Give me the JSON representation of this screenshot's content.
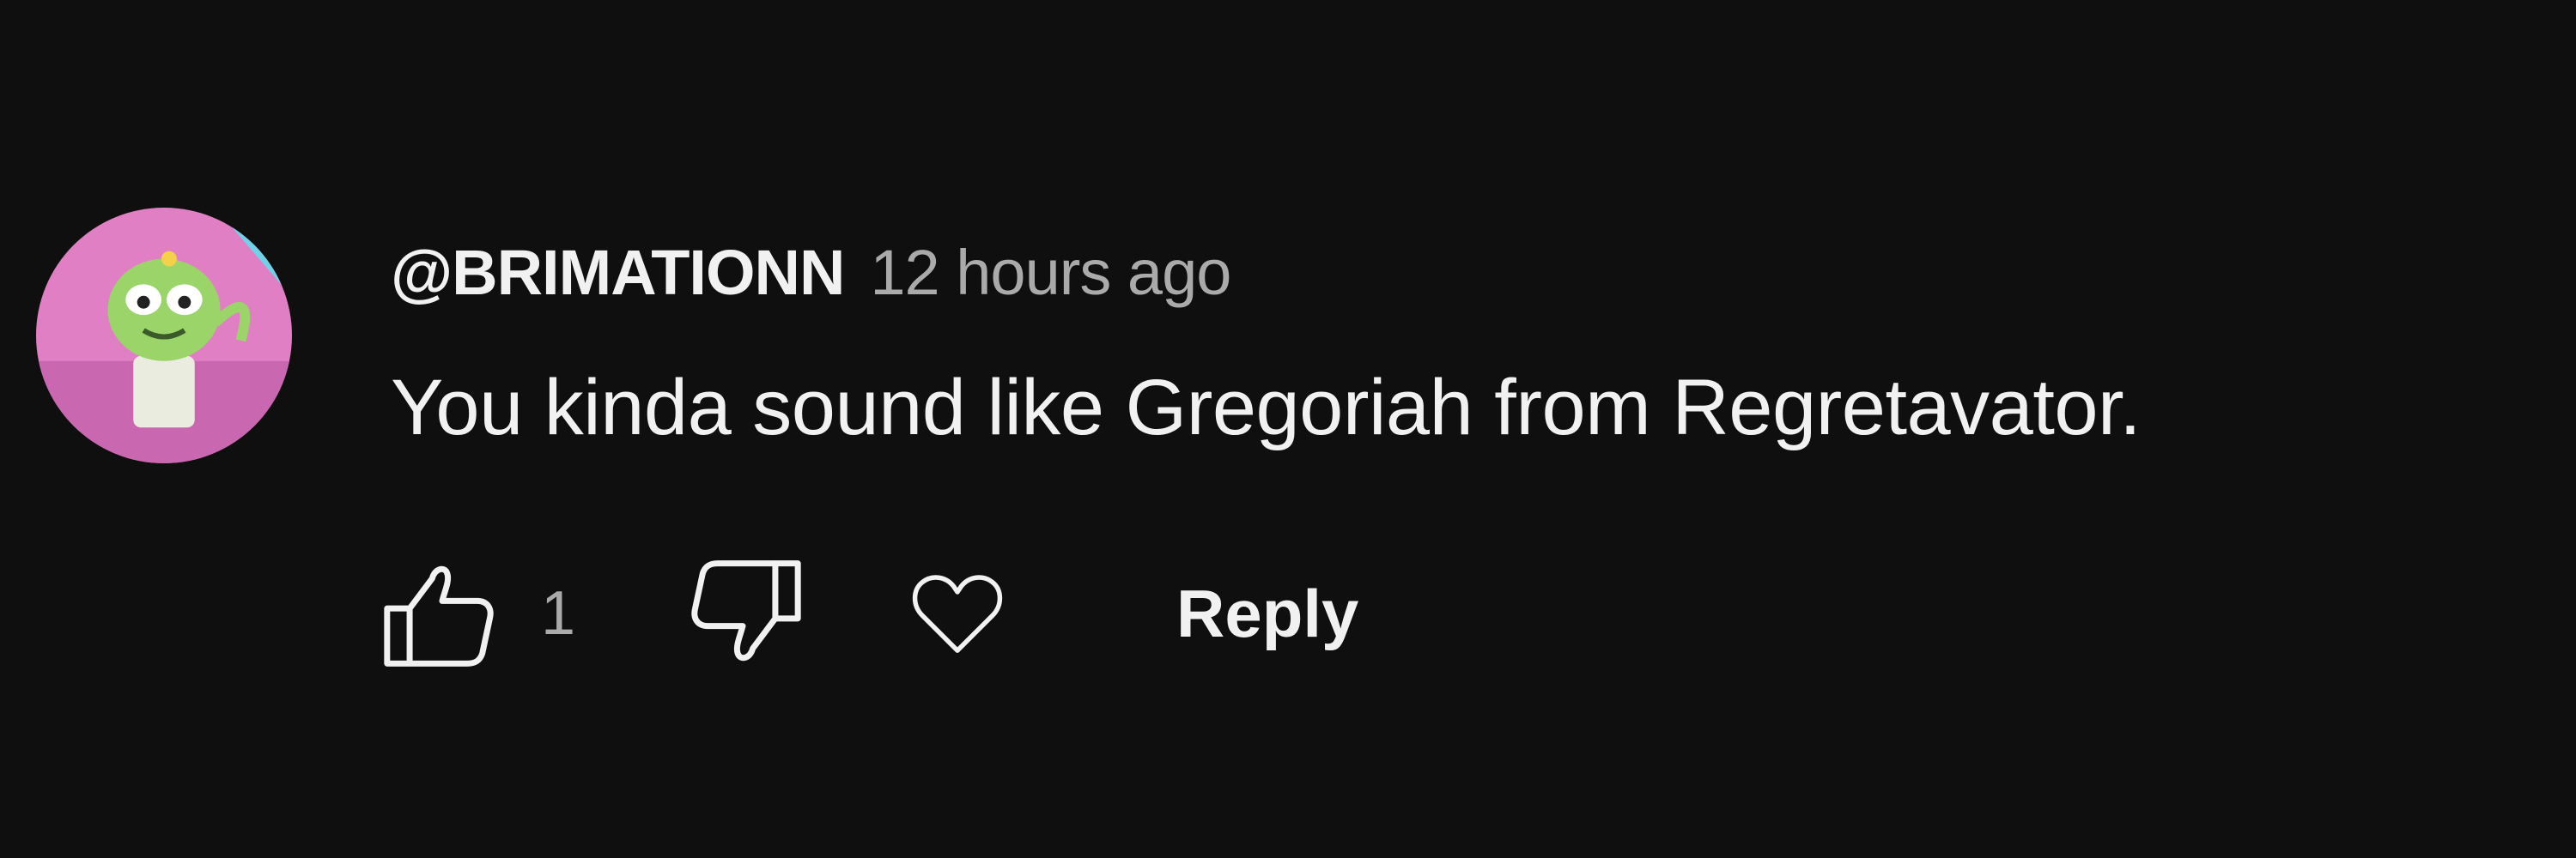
{
  "comment": {
    "author": "@BRIMATIONN",
    "time": "12 hours ago",
    "text": "You kinda sound like Gregoriah from Regretavator.",
    "like_count": "1",
    "reply_label": "Reply",
    "avatar_icon": "avatar-icon",
    "like_icon": "thumbs-up-icon",
    "dislike_icon": "thumbs-down-icon",
    "heart_icon": "heart-icon"
  },
  "colors": {
    "background": "#0f0f0f",
    "primary_text": "#f1f1f1",
    "secondary_text": "#aaaaaa",
    "avatar_bg": "#e07fc4"
  }
}
